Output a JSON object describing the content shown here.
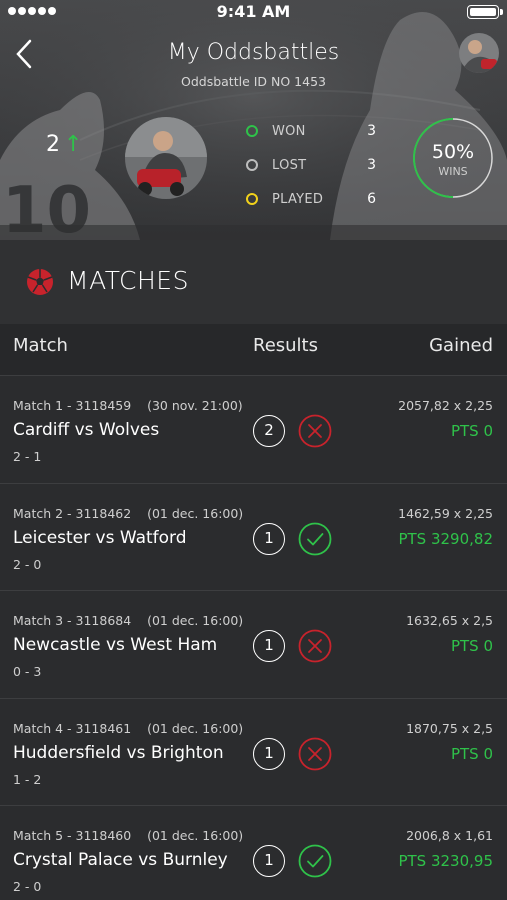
{
  "status_bar": {
    "time": "9:41 AM"
  },
  "header": {
    "title": "My Oddsbattles",
    "subtitle": "Oddsbattle ID NO 1453",
    "rank": "2",
    "stats": [
      {
        "label": "WON",
        "value": "3",
        "color": "#2fc24a"
      },
      {
        "label": "LOST",
        "value": "3",
        "color": "#bdbdbd"
      },
      {
        "label": "PLAYED",
        "value": "6",
        "color": "#f2d21b"
      }
    ],
    "wins_percent": "50%",
    "wins_label": "WINS",
    "wins_fraction": 0.5
  },
  "section": {
    "title": "MATCHES",
    "icon": "soccer-ball-icon"
  },
  "columns": {
    "match": "Match",
    "results": "Results",
    "gained": "Gained"
  },
  "colors": {
    "accent_green": "#2fc24a",
    "loss_red": "#c8232c",
    "background": "#2b2c2e"
  },
  "matches": [
    {
      "meta": "Match 1 - 3118459    (30 nov. 21:00)",
      "teams": "Cardiff vs Wolves",
      "score": "2 - 1",
      "pick": "2",
      "result": "loss",
      "odds": "2057,82 x 2,25",
      "points": "PTS 0"
    },
    {
      "meta": "Match 2 - 3118462    (01 dec. 16:00)",
      "teams": "Leicester vs Watford",
      "score": "2 - 0",
      "pick": "1",
      "result": "win",
      "odds": "1462,59 x 2,25",
      "points": "PTS 3290,82"
    },
    {
      "meta": "Match 3 - 3118684    (01 dec. 16:00)",
      "teams": "Newcastle vs West Ham",
      "score": "0 - 3",
      "pick": "1",
      "result": "loss",
      "odds": "1632,65 x 2,5",
      "points": "PTS 0"
    },
    {
      "meta": "Match 4 - 3118461    (01 dec. 16:00)",
      "teams": "Huddersfield vs Brighton",
      "score": "1 - 2",
      "pick": "1",
      "result": "loss",
      "odds": "1870,75 x 2,5",
      "points": "PTS 0"
    },
    {
      "meta": "Match 5 - 3118460    (01 dec. 16:00)",
      "teams": "Crystal Palace vs Burnley",
      "score": "2 - 0",
      "pick": "1",
      "result": "win",
      "odds": "2006,8 x 1,61",
      "points": "PTS 3230,95"
    }
  ]
}
